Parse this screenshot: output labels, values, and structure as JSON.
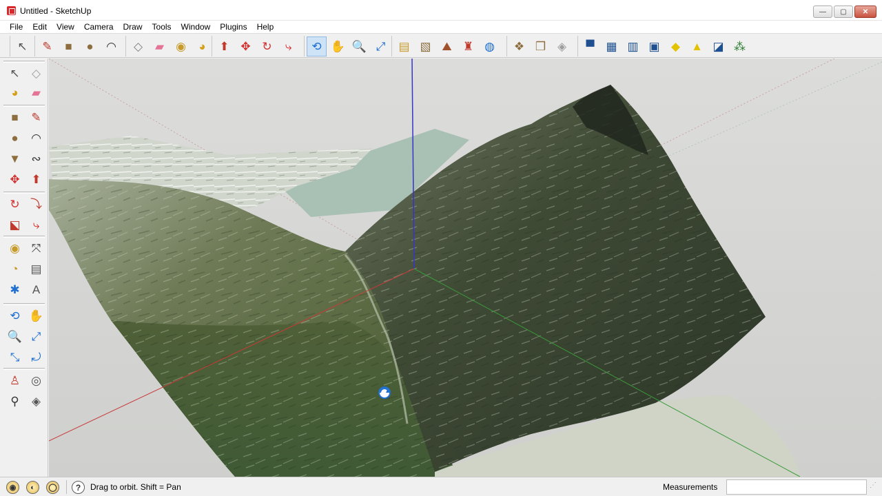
{
  "window": {
    "title": "Untitled - SketchUp",
    "minimize_glyph": "—",
    "maximize_glyph": "▢",
    "close_glyph": "✕"
  },
  "menu": {
    "items": [
      "File",
      "Edit",
      "View",
      "Camera",
      "Draw",
      "Tools",
      "Window",
      "Plugins",
      "Help"
    ]
  },
  "toolbar": {
    "tools": [
      {
        "name": "select-icon",
        "glyph": "↖",
        "color": "#555555"
      },
      {
        "name": "line-icon",
        "glyph": "✎",
        "color": "#c0392b"
      },
      {
        "name": "rectangle-icon",
        "glyph": "■",
        "color": "#8d6e3f"
      },
      {
        "name": "circle-icon",
        "glyph": "●",
        "color": "#8d6e3f"
      },
      {
        "name": "arc-icon",
        "glyph": "◠",
        "color": "#333333"
      },
      {
        "name": "make-component-icon",
        "glyph": "◇",
        "color": "#7f7f7f"
      },
      {
        "name": "eraser-icon",
        "glyph": "▰",
        "color": "#e57396"
      },
      {
        "name": "tape-measure-icon",
        "glyph": "◉",
        "color": "#c79a2a"
      },
      {
        "name": "paint-bucket-icon",
        "glyph": "◕",
        "color": "#d4a017"
      },
      {
        "name": "push-pull-icon",
        "glyph": "⬆",
        "color": "#c0392b"
      },
      {
        "name": "move-icon",
        "glyph": "✥",
        "color": "#d32f2f"
      },
      {
        "name": "rotate-icon",
        "glyph": "↻",
        "color": "#d32f2f"
      },
      {
        "name": "follow-me-icon",
        "glyph": "⤷",
        "color": "#d32f2f"
      },
      {
        "name": "orbit-icon",
        "glyph": "⟲",
        "color": "#1e6fd0"
      },
      {
        "name": "pan-icon",
        "glyph": "✋",
        "color": "#666666"
      },
      {
        "name": "zoom-icon",
        "glyph": "🔍",
        "color": "#1e6fd0"
      },
      {
        "name": "zoom-extents-icon",
        "glyph": "⤢",
        "color": "#1e6fd0"
      },
      {
        "name": "get-current-view-icon",
        "glyph": "▤",
        "color": "#c79a2a"
      },
      {
        "name": "toggle-terrain-icon",
        "glyph": "▧",
        "color": "#8d6e3f"
      },
      {
        "name": "add-location-icon",
        "glyph": "⛰",
        "color": "#a0522d"
      },
      {
        "name": "add-building-icon",
        "glyph": "♜",
        "color": "#c0392b"
      },
      {
        "name": "preview-google-earth-icon",
        "glyph": "◍",
        "color": "#1e6fd0"
      },
      {
        "name": "get-models-icon",
        "glyph": "❖",
        "color": "#8d6e3f"
      },
      {
        "name": "share-model-icon",
        "glyph": "❒",
        "color": "#8d6e3f"
      },
      {
        "name": "share-component-icon",
        "glyph": "◈",
        "color": "#9e9e9e"
      },
      {
        "name": "sandbox-from-contours-icon",
        "glyph": "▀",
        "color": "#1d4f91"
      },
      {
        "name": "sandbox-from-scratch-icon",
        "glyph": "▦",
        "color": "#1d4f91"
      },
      {
        "name": "sandbox-smoove-icon",
        "glyph": "▥",
        "color": "#1d4f91"
      },
      {
        "name": "sandbox-stamp-icon",
        "glyph": "▣",
        "color": "#1d4f91"
      },
      {
        "name": "sandbox-drape-icon",
        "glyph": "◆",
        "color": "#e3c200"
      },
      {
        "name": "sandbox-add-detail-icon",
        "glyph": "▲",
        "color": "#e3c200"
      },
      {
        "name": "sandbox-flip-edge-icon",
        "glyph": "◪",
        "color": "#1d4f91"
      },
      {
        "name": "styles-icon",
        "glyph": "⁂",
        "color": "#2e7d32"
      }
    ]
  },
  "left_toolbar": {
    "tools": [
      {
        "name": "select-icon",
        "glyph": "↖",
        "color": "#555555"
      },
      {
        "name": "make-component-icon",
        "glyph": "◇",
        "color": "#9e9e9e"
      },
      {
        "name": "paint-bucket-icon",
        "glyph": "◕",
        "color": "#d4a017"
      },
      {
        "name": "eraser-icon",
        "glyph": "▰",
        "color": "#e57396"
      },
      {
        "name": "rectangle-icon",
        "glyph": "■",
        "color": "#8d6e3f"
      },
      {
        "name": "line-icon",
        "glyph": "✎",
        "color": "#c0392b"
      },
      {
        "name": "circle-icon",
        "glyph": "●",
        "color": "#8d6e3f"
      },
      {
        "name": "arc-icon",
        "glyph": "◠",
        "color": "#333333"
      },
      {
        "name": "polygon-icon",
        "glyph": "▼",
        "color": "#8d6e3f"
      },
      {
        "name": "freehand-icon",
        "glyph": "∾",
        "color": "#333333"
      },
      {
        "name": "move-icon",
        "glyph": "✥",
        "color": "#d32f2f"
      },
      {
        "name": "push-pull-icon",
        "glyph": "⬆",
        "color": "#c0392b"
      },
      {
        "name": "rotate-icon",
        "glyph": "↻",
        "color": "#d32f2f"
      },
      {
        "name": "follow-me-icon",
        "glyph": "⤵",
        "color": "#c0392b"
      },
      {
        "name": "scale-icon",
        "glyph": "⬕",
        "color": "#c0392b"
      },
      {
        "name": "offset-icon",
        "glyph": "⤷",
        "color": "#d32f2f"
      },
      {
        "name": "tape-measure-icon",
        "glyph": "◉",
        "color": "#c79a2a"
      },
      {
        "name": "dimension-icon",
        "glyph": "⤧",
        "color": "#333333"
      },
      {
        "name": "protractor-icon",
        "glyph": "◔",
        "color": "#c79a2a"
      },
      {
        "name": "text-icon",
        "glyph": "▤",
        "color": "#555555"
      },
      {
        "name": "axes-icon",
        "glyph": "✱",
        "color": "#1e6fd0"
      },
      {
        "name": "3d-text-icon",
        "glyph": "A",
        "color": "#555555"
      },
      {
        "name": "orbit-icon",
        "glyph": "⟲",
        "color": "#1e6fd0"
      },
      {
        "name": "pan-icon",
        "glyph": "✋",
        "color": "#666666"
      },
      {
        "name": "zoom-icon",
        "glyph": "🔍",
        "color": "#1e6fd0"
      },
      {
        "name": "zoom-window-icon",
        "glyph": "⤢",
        "color": "#1e6fd0"
      },
      {
        "name": "zoom-extents-icon",
        "glyph": "⤡",
        "color": "#1e6fd0"
      },
      {
        "name": "previous-view-icon",
        "glyph": "⤾",
        "color": "#1e6fd0"
      },
      {
        "name": "position-camera-icon",
        "glyph": "♙",
        "color": "#c0392b"
      },
      {
        "name": "look-around-icon",
        "glyph": "◎",
        "color": "#555555"
      },
      {
        "name": "walk-icon",
        "glyph": "⚲",
        "color": "#333333"
      },
      {
        "name": "section-plane-icon",
        "glyph": "◈",
        "color": "#555555"
      }
    ]
  },
  "status": {
    "geo_icon_glyph": "◉",
    "credits_icon_glyph": "◐",
    "user_icon_glyph": "◯",
    "help_glyph": "?",
    "text": "Drag to orbit.  Shift = Pan",
    "measurements_label": "Measurements",
    "measurements_value": "",
    "resize_glyph": "⋰"
  }
}
